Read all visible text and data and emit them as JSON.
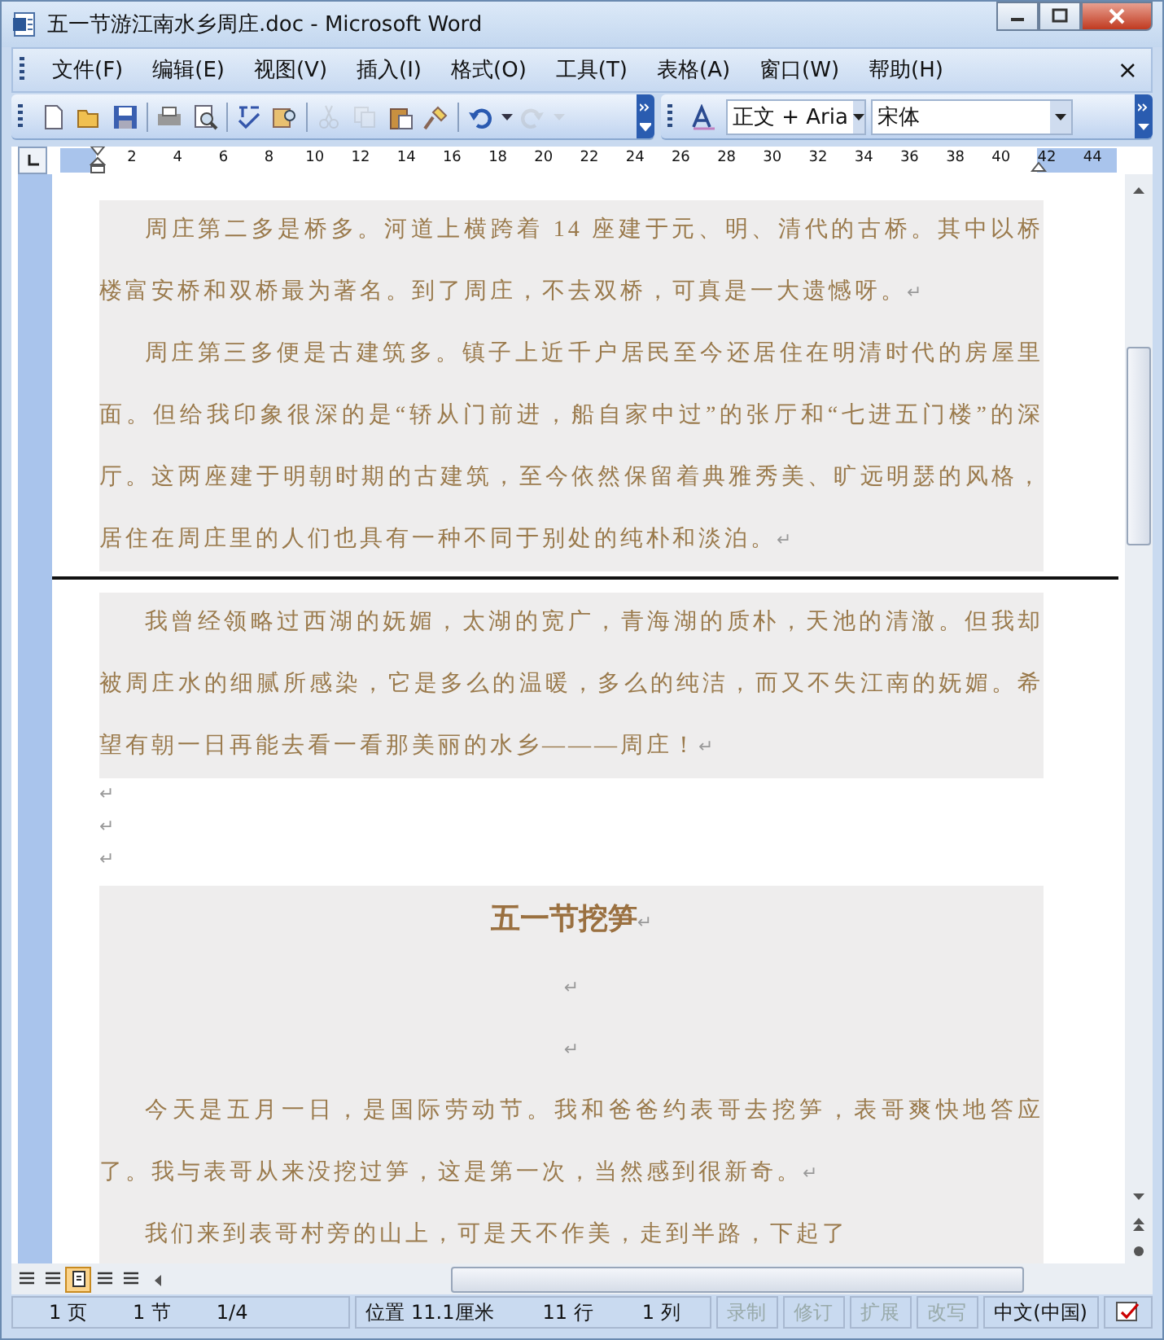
{
  "window": {
    "title": "五一节游江南水乡周庄.doc - Microsoft Word"
  },
  "menu": {
    "items": [
      "文件(F)",
      "编辑(E)",
      "视图(V)",
      "插入(I)",
      "格式(O)",
      "工具(T)",
      "表格(A)",
      "窗口(W)",
      "帮助(H)"
    ],
    "close": "×"
  },
  "toolbar": {
    "buttons": [
      {
        "kind": "new",
        "disabled": false
      },
      {
        "kind": "open",
        "disabled": false
      },
      {
        "kind": "save",
        "disabled": false
      },
      {
        "kind": "print",
        "disabled": false
      },
      {
        "kind": "preview",
        "disabled": false
      },
      {
        "kind": "spelling",
        "disabled": false
      },
      {
        "kind": "research",
        "disabled": false
      },
      {
        "kind": "cut",
        "disabled": true
      },
      {
        "kind": "copy",
        "disabled": true
      },
      {
        "kind": "paste",
        "disabled": false
      },
      {
        "kind": "painter",
        "disabled": false
      },
      {
        "kind": "undo",
        "disabled": false
      },
      {
        "kind": "drop",
        "disabled": false
      },
      {
        "kind": "redo",
        "disabled": true
      },
      {
        "kind": "drop",
        "disabled": true
      }
    ],
    "style": "正文 + Aria",
    "font": "宋体"
  },
  "ruler": {
    "numbers": [
      "2",
      "4",
      "6",
      "8",
      "10",
      "12",
      "14",
      "16",
      "18",
      "20",
      "22",
      "24",
      "26",
      "28",
      "30",
      "32",
      "34",
      "36",
      "38",
      "40",
      "42",
      "44"
    ]
  },
  "document": {
    "blocks": [
      {
        "kind": "body",
        "shaded": true,
        "text": "周庄第二多是桥多。河道上横跨着 14 座建于元、明、清代的古桥。其中以桥楼富安桥和双桥最为著名。到了周庄，不去双桥，可真是一大遗憾呀。",
        "mark": "↵"
      },
      {
        "kind": "body",
        "shaded": true,
        "text": "周庄第三多便是古建筑多。镇子上近千户居民至今还居住在明清时代的房屋里面。但给我印象很深的是“轿从门前进，船自家中过”的张厅和“七进五门楼”的深厅。这两座建于明朝时期的古建筑，至今依然保留着典雅秀美、旷远明瑟的风格，居住在周庄里的人们也具有一种不同于别处的纯朴和淡泊。",
        "mark": "↵"
      },
      {
        "kind": "break"
      },
      {
        "kind": "body",
        "shaded": true,
        "text": "我曾经领略过西湖的妩媚，太湖的宽广，青海湖的质朴，天池的清澈。但我却被周庄水的细腻所感染，它是多么的温暖，多么的纯洁，而又不失江南的妩媚。希望有朝一日再能去看一看那美丽的水乡———周庄！",
        "mark": "↵"
      },
      {
        "kind": "empty",
        "shaded": false,
        "mark": "↵"
      },
      {
        "kind": "empty",
        "shaded": false,
        "mark": "↵"
      },
      {
        "kind": "empty",
        "shaded": false,
        "mark": "↵"
      },
      {
        "kind": "heading",
        "shaded": true,
        "text": "五一节挖笋",
        "mark": "↵"
      },
      {
        "kind": "blank",
        "shaded": true,
        "mark": "↵"
      },
      {
        "kind": "blank",
        "shaded": true,
        "mark": "↵"
      },
      {
        "kind": "body",
        "shaded": true,
        "text": "今天是五月一日，是国际劳动节。我和爸爸约表哥去挖笋，表哥爽快地答应了。我与表哥从来没挖过笋，这是第一次，当然感到很新奇。",
        "mark": "↵"
      },
      {
        "kind": "body",
        "shaded": true,
        "text": "我们来到表哥村旁的山上，可是天不作美，走到半路，下起了"
      }
    ]
  },
  "views": [
    {
      "selected": false
    },
    {
      "selected": false
    },
    {
      "selected": true
    },
    {
      "selected": false
    },
    {
      "selected": false
    }
  ],
  "status": {
    "fields": [
      {
        "text": "1 页",
        "disabled": false
      },
      {
        "text": "1 节",
        "disabled": false
      },
      {
        "text": "1/4",
        "disabled": false
      },
      {
        "text": "位置 11.1厘米",
        "disabled": false
      },
      {
        "text": "11 行",
        "disabled": false
      },
      {
        "text": "1 列",
        "disabled": false
      },
      {
        "text": "录制",
        "disabled": true
      },
      {
        "text": "修订",
        "disabled": true
      },
      {
        "text": "扩展",
        "disabled": true
      },
      {
        "text": "改写",
        "disabled": true
      },
      {
        "text": "中文(中国)",
        "disabled": false
      }
    ]
  }
}
